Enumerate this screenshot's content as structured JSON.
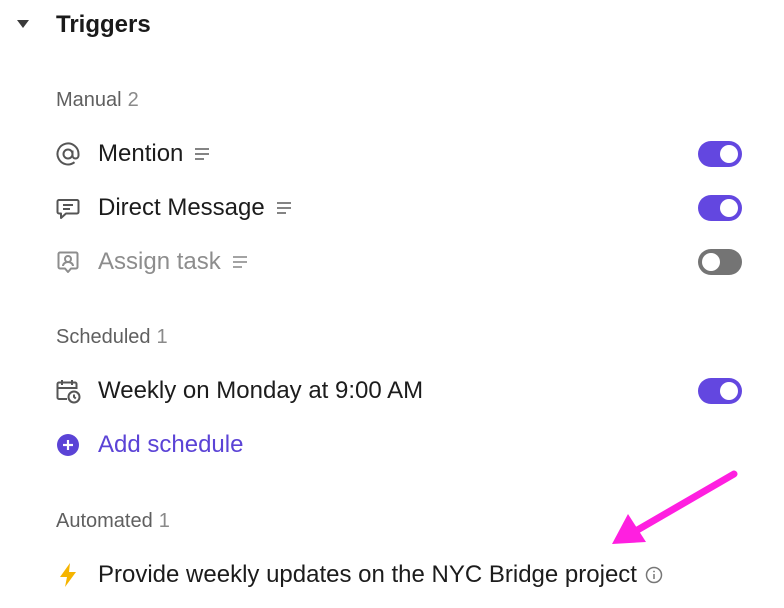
{
  "header": {
    "title": "Triggers",
    "caret_icon": "caret-down-icon"
  },
  "sections": {
    "manual": {
      "label": "Manual",
      "count": "2",
      "items": [
        {
          "label": "Mention",
          "icon": "at-sign-icon",
          "enabled": true
        },
        {
          "label": "Direct Message",
          "icon": "chat-bubble-icon",
          "enabled": true
        },
        {
          "label": "Assign task",
          "icon": "assign-task-icon",
          "enabled": false
        }
      ]
    },
    "scheduled": {
      "label": "Scheduled",
      "count": "1",
      "items": [
        {
          "label": "Weekly on Monday at 9:00 AM",
          "icon": "calendar-clock-icon",
          "enabled": true
        }
      ],
      "add_label": "Add schedule",
      "add_icon": "plus-circle-icon"
    },
    "automated": {
      "label": "Automated",
      "count": "1",
      "items": [
        {
          "label": "Provide weekly updates on the NYC Bridge project",
          "icon": "lightning-bolt-icon"
        }
      ]
    }
  },
  "colors": {
    "accent": "#6347e0",
    "accent_text": "#5b43d6",
    "toggle_off": "#747474",
    "bolt": "#f5b400",
    "annotation_arrow": "#ff1fe0"
  }
}
